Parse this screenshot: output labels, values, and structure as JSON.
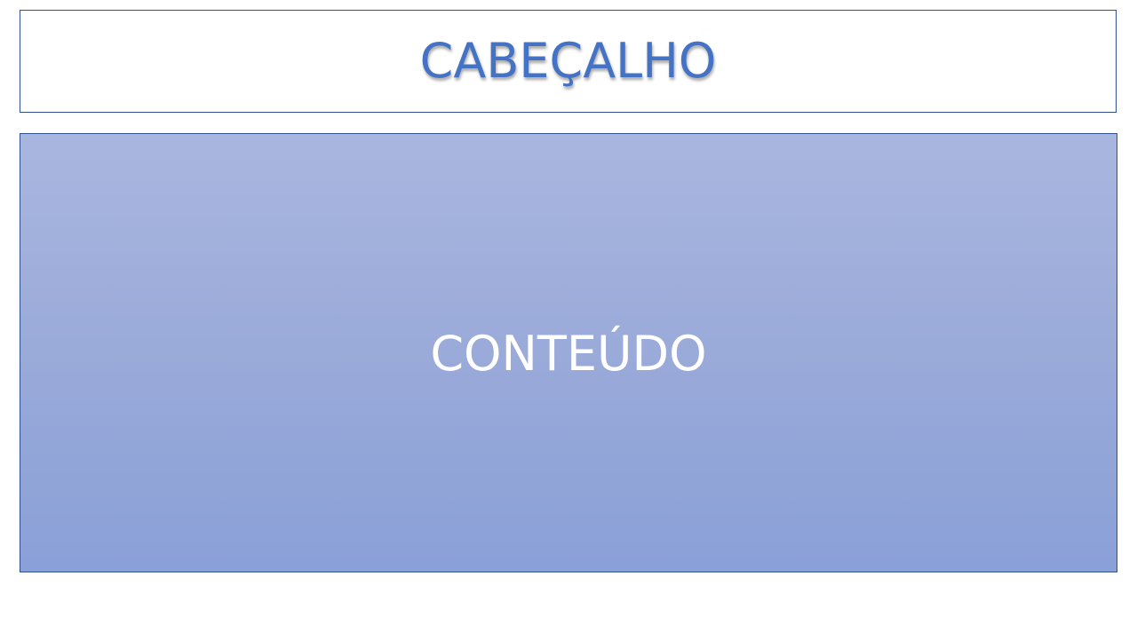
{
  "header": {
    "label": "CABEÇALHO",
    "color": "#4472c4",
    "border_color": "#2f528f"
  },
  "content": {
    "label": "CONTEÚDO",
    "text_color": "#ffffff",
    "gradient_top": "#a9b6df",
    "gradient_bottom": "#8aa0d8",
    "border_color": "#2f528f"
  }
}
